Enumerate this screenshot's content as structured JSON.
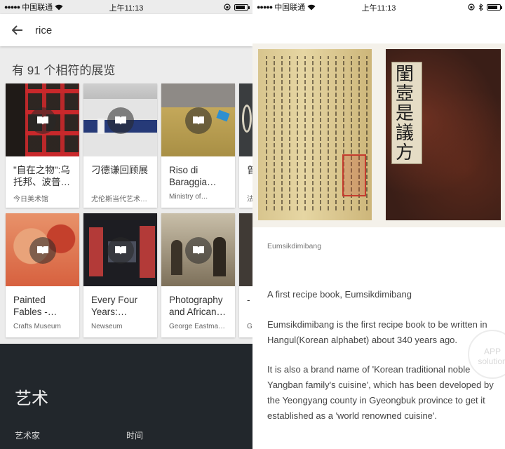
{
  "left_status": {
    "carrier": "中国联通",
    "time": "上午11:13"
  },
  "right_status": {
    "carrier": "中国联通",
    "time": "上午11:13"
  },
  "search": {
    "query": "rice"
  },
  "results": {
    "title": "有 91 个相符的展览"
  },
  "cards": [
    {
      "title": "\"自在之物\":乌托邦、波普…",
      "subtitle": "今日美术馆"
    },
    {
      "title": "刁德谦回顾展",
      "subtitle": "尤伦斯当代艺术…"
    },
    {
      "title": "Riso di Baraggia…",
      "subtitle": "Ministry of…"
    },
    {
      "title": "曾…",
      "subtitle": "法…"
    },
    {
      "title": "Painted Fables -…",
      "subtitle": "Crafts Museum"
    },
    {
      "title": "Every Four Years:…",
      "subtitle": "Newseum"
    },
    {
      "title": "Photography and African…",
      "subtitle": "George Eastma…"
    },
    {
      "title": "- T…",
      "subtitle": "G…"
    }
  ],
  "footer": {
    "title": "艺术",
    "col1": "艺术家",
    "col2": "时间"
  },
  "detail": {
    "caption": "Eumsikdimibang",
    "paragraphs": [
      "A first recipe book, Eumsikdimibang",
      "Eumsikdimibang is the first recipe book to be written in Hangul(Korean alphabet) about 340 years ago.",
      "It is also a brand name of 'Korean traditional noble Yangban family's cuisine', which has been developed by the Yeongyang county in Gyeongbuk province to get it established as a 'world renowned cuisine'."
    ],
    "book_cover_title": "閨壼是議方"
  },
  "watermark": "APP solution",
  "colors": {
    "footer_bg": "#22272c",
    "page_bg": "#ececec"
  }
}
